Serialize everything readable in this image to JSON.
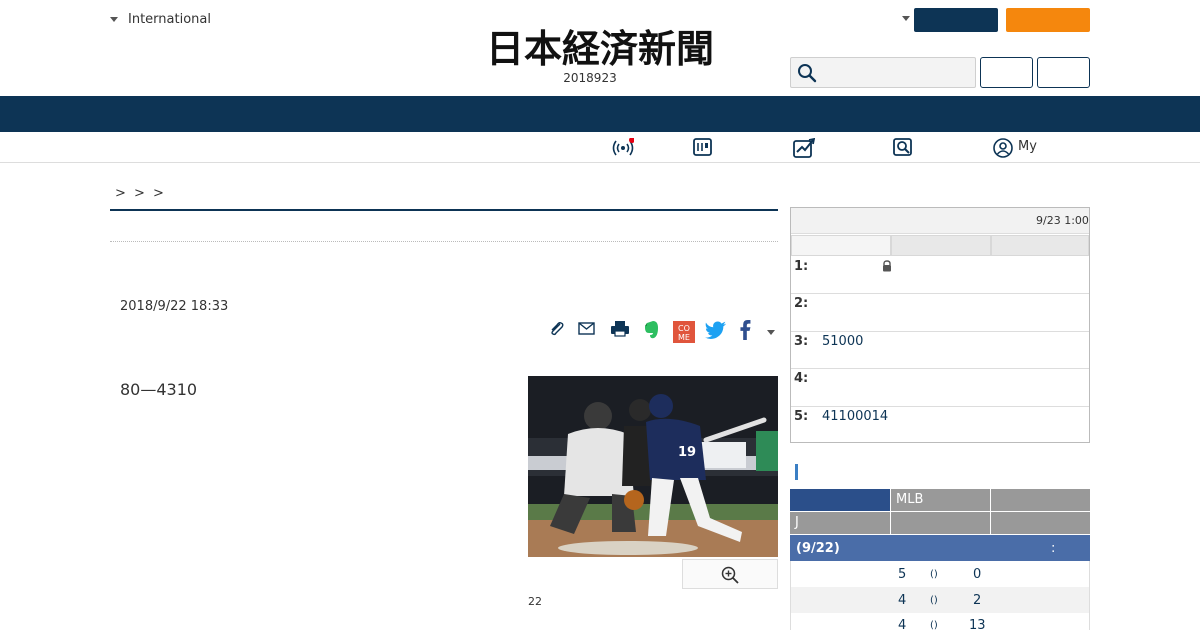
{
  "header": {
    "edition_label": "International",
    "logo_text": "日本経済新聞",
    "date": "2018923",
    "subnav_my_label": "My"
  },
  "article": {
    "breadcrumb": "> > >",
    "published": "2018/9/22 18:33",
    "lead": "80—4310",
    "photo_caption": "22"
  },
  "ranking": {
    "updated": "9/23 1:00",
    "items": [
      {
        "rank": "1:",
        "text": ""
      },
      {
        "rank": "2:",
        "text": ""
      },
      {
        "rank": "3:",
        "text": "51000"
      },
      {
        "rank": "4:",
        "text": ""
      },
      {
        "rank": "5:",
        "text": "41100014"
      }
    ]
  },
  "sports": {
    "tabs_row1": [
      "",
      "MLB",
      ""
    ],
    "tabs_row2": [
      "J",
      "",
      ""
    ],
    "score_header": "(9/22)",
    "score_header_sep": ":",
    "scores": [
      {
        "a": "5",
        "mid": "()",
        "b": "0"
      },
      {
        "a": "4",
        "mid": "()",
        "b": "2"
      },
      {
        "a": "4",
        "mid": "()",
        "b": "13"
      }
    ]
  },
  "icons": [
    "caret-down-icon",
    "search-icon",
    "live-broadcast-icon",
    "newspaper-icon",
    "market-chart-icon",
    "search-zoom-icon",
    "user-icon",
    "clip-icon",
    "mail-icon",
    "print-icon",
    "evernote-icon",
    "comment-icon",
    "twitter-icon",
    "facebook-icon",
    "lock-icon",
    "zoom-in-icon"
  ],
  "colors": {
    "brand_navy": "#0d3455",
    "accent_orange": "#f5870d",
    "score_blue": "#4a6da8",
    "tab_blue": "#2b4f8a"
  }
}
